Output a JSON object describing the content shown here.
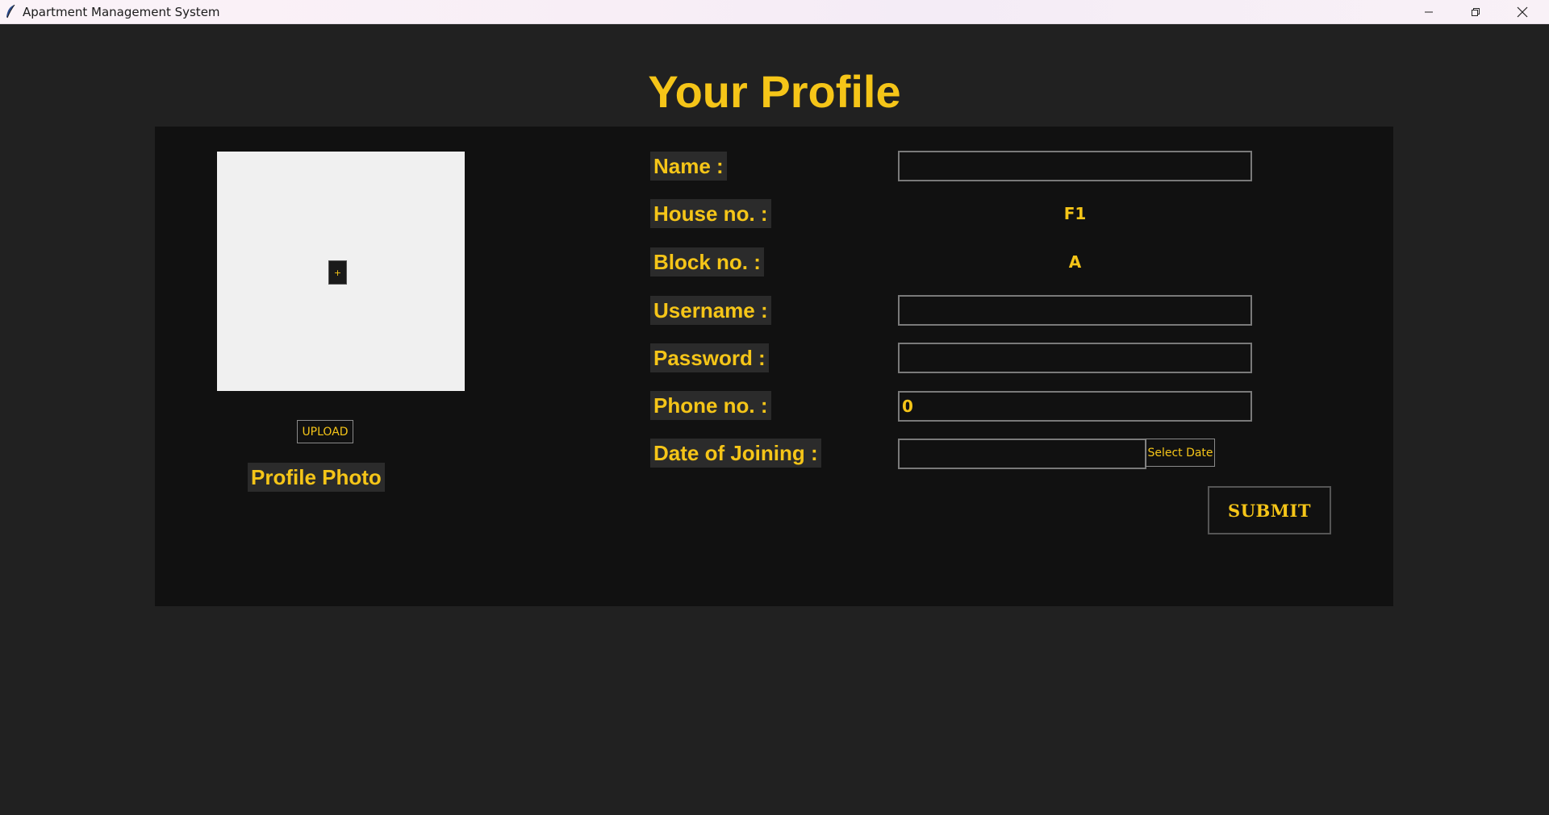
{
  "window": {
    "title": "Apartment Management System",
    "icon": "feather-icon"
  },
  "heading": "Your Profile",
  "profile_photo": {
    "add_label": "+",
    "upload_label": "UPLOAD",
    "caption": "Profile Photo"
  },
  "form": {
    "name": {
      "label": "Name :",
      "value": ""
    },
    "house_no": {
      "label": "House no. :",
      "value": "F1"
    },
    "block_no": {
      "label": "Block no. :",
      "value": "A"
    },
    "username": {
      "label": "Username :",
      "value": ""
    },
    "password": {
      "label": "Password :",
      "value": ""
    },
    "phone_no": {
      "label": "Phone no. :",
      "value": "0"
    },
    "date_of_joining": {
      "label": "Date of Joining :",
      "value": "",
      "button_label": "Select Date"
    },
    "submit_label": "SUBMIT"
  },
  "colors": {
    "background": "#212121",
    "panel": "#111111",
    "accent": "#f5c518"
  }
}
